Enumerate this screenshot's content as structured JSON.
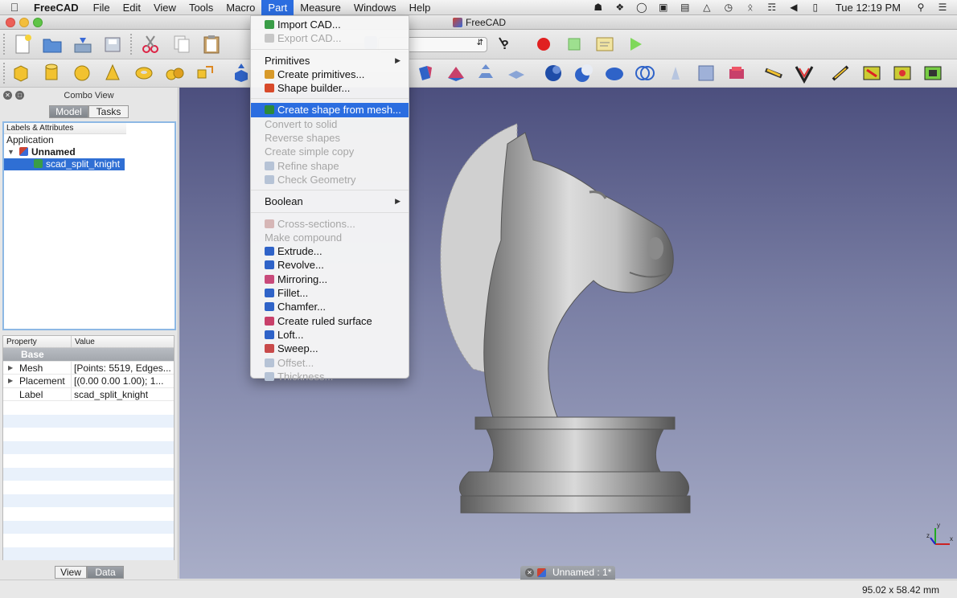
{
  "menubar": {
    "app_name": "FreeCAD",
    "menus": [
      "File",
      "Edit",
      "View",
      "Tools",
      "Macro",
      "Part",
      "Measure",
      "Windows",
      "Help"
    ],
    "active_menu": "Part",
    "clock": "Tue 12:19 PM"
  },
  "window": {
    "title": "FreeCAD"
  },
  "part_menu": {
    "items": [
      {
        "label": "Import CAD...",
        "enabled": true,
        "icon": "import-icon",
        "color": "#3a9d47"
      },
      {
        "label": "Export CAD...",
        "enabled": false,
        "icon": "export-icon",
        "color": "#c7c7c7"
      },
      {
        "label": "Primitives",
        "enabled": true,
        "submenu": true
      },
      {
        "label": "Create primitives...",
        "enabled": true,
        "icon": "primitives-icon",
        "color": "#d89a2a"
      },
      {
        "label": "Shape builder...",
        "enabled": true,
        "icon": "shape-builder-icon",
        "color": "#d84a2a"
      },
      {
        "label": "Create shape from mesh...",
        "enabled": true,
        "highlighted": true,
        "icon": "mesh-to-shape-icon",
        "color": "#2d8a3a"
      },
      {
        "label": "Convert to solid",
        "enabled": false
      },
      {
        "label": "Reverse shapes",
        "enabled": false
      },
      {
        "label": "Create simple copy",
        "enabled": false
      },
      {
        "label": "Refine shape",
        "enabled": false,
        "icon": "refine-icon",
        "color": "#b6c3d6"
      },
      {
        "label": "Check Geometry",
        "enabled": false,
        "icon": "check-geometry-icon",
        "color": "#b6c3d6"
      },
      {
        "label": "Boolean",
        "enabled": true,
        "submenu": true
      },
      {
        "label": "Cross-sections...",
        "enabled": false,
        "icon": "cross-section-icon",
        "color": "#d6b6b6"
      },
      {
        "label": "Make compound",
        "enabled": false
      },
      {
        "label": "Extrude...",
        "enabled": true,
        "icon": "extrude-icon",
        "color": "#2f63c8"
      },
      {
        "label": "Revolve...",
        "enabled": true,
        "icon": "revolve-icon",
        "color": "#2f63c8"
      },
      {
        "label": "Mirroring...",
        "enabled": true,
        "icon": "mirror-icon",
        "color": "#c84a7a"
      },
      {
        "label": "Fillet...",
        "enabled": true,
        "icon": "fillet-icon",
        "color": "#2f63c8"
      },
      {
        "label": "Chamfer...",
        "enabled": true,
        "icon": "chamfer-icon",
        "color": "#2f63c8"
      },
      {
        "label": "Create ruled surface",
        "enabled": true,
        "icon": "ruled-surface-icon",
        "color": "#c8406a"
      },
      {
        "label": "Loft...",
        "enabled": true,
        "icon": "loft-icon",
        "color": "#2f63c8"
      },
      {
        "label": "Sweep...",
        "enabled": true,
        "icon": "sweep-icon",
        "color": "#c84a4a"
      },
      {
        "label": "Offset...",
        "enabled": false,
        "icon": "offset-icon",
        "color": "#b6c3d6"
      },
      {
        "label": "Thickness...",
        "enabled": false,
        "icon": "thickness-icon",
        "color": "#b6c3d6"
      }
    ]
  },
  "combo_view": {
    "title": "Combo View",
    "tabs": [
      "Model",
      "Tasks"
    ],
    "active_tab": "Model",
    "tree_header": "Labels & Attributes",
    "tree": {
      "root": "Application",
      "document": "Unnamed",
      "object": "scad_split_knight"
    },
    "property_headers": [
      "Property",
      "Value"
    ],
    "properties": [
      {
        "group": "Base"
      },
      {
        "key": "Mesh",
        "value": "[Points: 5519, Edges...",
        "expandable": true
      },
      {
        "key": "Placement",
        "value": "[(0.00 0.00 1.00); 1...",
        "expandable": true
      },
      {
        "key": "Label",
        "value": "scad_split_knight",
        "expandable": false
      }
    ],
    "bottom_tabs": [
      "View",
      "Data"
    ],
    "active_bottom_tab": "Data"
  },
  "viewport": {
    "document_tab": "Unnamed : 1*",
    "axis_labels": [
      "x",
      "y",
      "z"
    ]
  },
  "status": {
    "dimensions": "95.02 x 58.42 mm"
  }
}
